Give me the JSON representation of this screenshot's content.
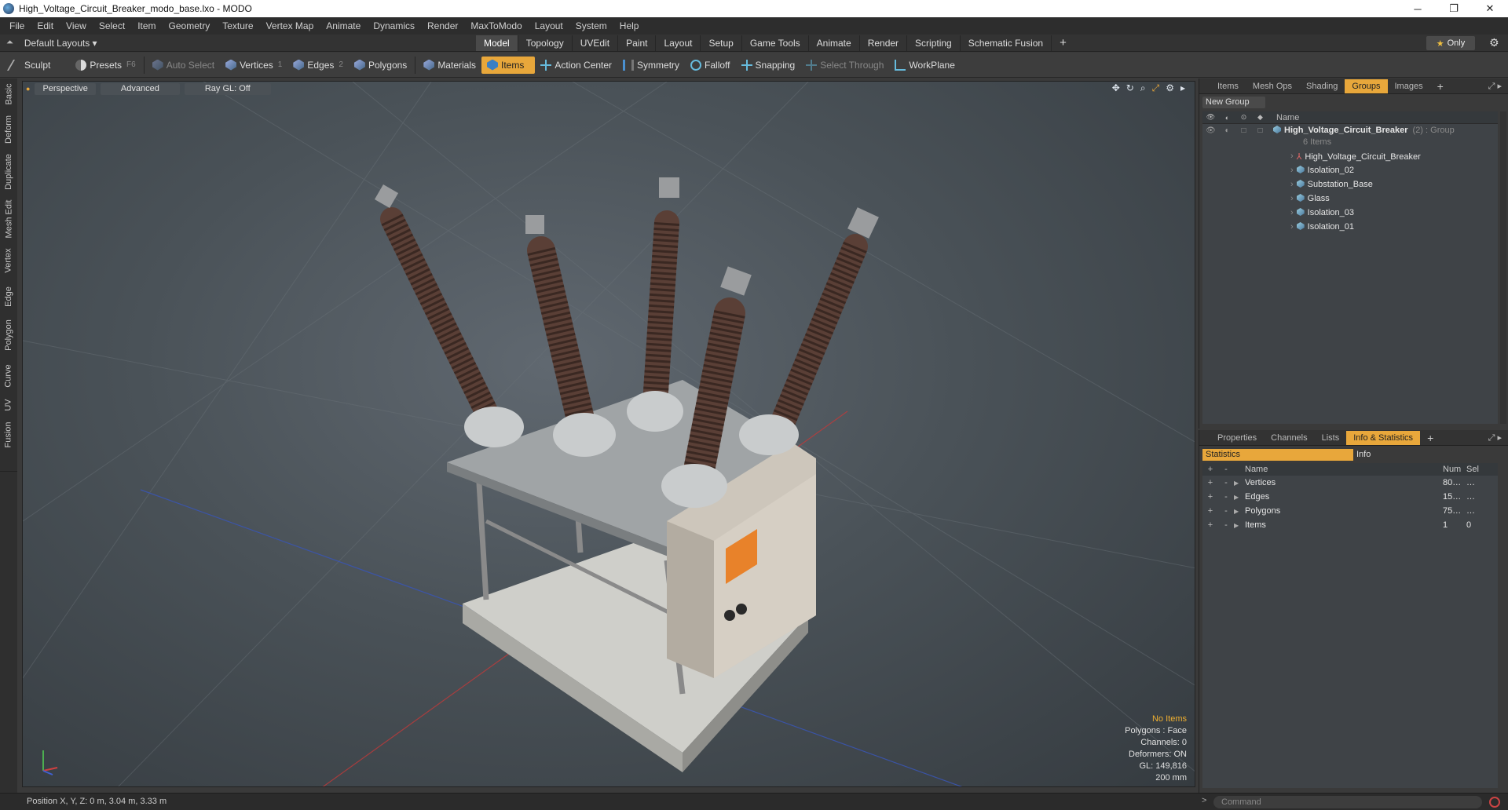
{
  "window": {
    "title": "High_Voltage_Circuit_Breaker_modo_base.lxo - MODO",
    "minimize": "─",
    "maximize": "❐",
    "close": "✕"
  },
  "menu": [
    "File",
    "Edit",
    "View",
    "Select",
    "Item",
    "Geometry",
    "Texture",
    "Vertex Map",
    "Animate",
    "Dynamics",
    "Render",
    "MaxToModo",
    "Layout",
    "System",
    "Help"
  ],
  "layout": {
    "selector": "Default Layouts ▾",
    "tabs": [
      "Model",
      "Topology",
      "UVEdit",
      "Paint",
      "Layout",
      "Setup",
      "Game Tools",
      "Animate",
      "Render",
      "Scripting",
      "Schematic Fusion"
    ],
    "active_tab": "Model",
    "only_label": "Only"
  },
  "toolbar": {
    "sculpt": "Sculpt",
    "presets": "Presets",
    "presets_key": "F6",
    "auto_select": "Auto Select",
    "vertices": "Vertices",
    "vertices_key": "1",
    "edges": "Edges",
    "edges_key": "2",
    "polygons": "Polygons",
    "materials": "Materials",
    "items": "Items",
    "action_center": "Action Center",
    "symmetry": "Symmetry",
    "falloff": "Falloff",
    "snapping": "Snapping",
    "select_through": "Select Through",
    "workplane": "WorkPlane"
  },
  "left_tabs": [
    "Basic",
    "Deform",
    "Duplicate",
    "Mesh Edit",
    "Vertex",
    "Edge",
    "Polygon",
    "Curve",
    "UV",
    "Fusion"
  ],
  "viewport": {
    "view_mode": "Perspective",
    "shading": "Advanced",
    "raygl": "Ray GL: Off",
    "info": {
      "items": "No Items",
      "polygons": "Polygons : Face",
      "channels": "Channels: 0",
      "deformers": "Deformers: ON",
      "gl": "GL: 149,816",
      "scale": "200 mm"
    }
  },
  "groups_panel": {
    "tabs": [
      "Items",
      "Mesh Ops",
      "Shading",
      "Groups",
      "Images"
    ],
    "active_tab": "Groups",
    "new_group": "New Group",
    "name_header": "Name",
    "group_name": "High_Voltage_Circuit_Breaker",
    "group_suffix": "(2) : Group",
    "group_count": "6 Items",
    "items": [
      "High_Voltage_Circuit_Breaker",
      "Isolation_02",
      "Substation_Base",
      "Glass",
      "Isolation_03",
      "Isolation_01"
    ]
  },
  "stats_panel": {
    "tabs": [
      "Properties",
      "Channels",
      "Lists",
      "Info & Statistics"
    ],
    "active_tab": "Info & Statistics",
    "subtab_statistics": "Statistics",
    "subtab_info": "Info",
    "headers": {
      "name": "Name",
      "num": "Num",
      "sel": "Sel"
    },
    "rows": [
      {
        "name": "Vertices",
        "num": "80…",
        "sel": "…"
      },
      {
        "name": "Edges",
        "num": "15…",
        "sel": "…"
      },
      {
        "name": "Polygons",
        "num": "75…",
        "sel": "…"
      },
      {
        "name": "Items",
        "num": "1",
        "sel": "0"
      }
    ]
  },
  "status": {
    "position": "Position X, Y, Z:  0 m, 3.04 m, 3.33 m",
    "command_placeholder": "Command"
  },
  "colors": {
    "accent": "#e8a73b",
    "viewport_bg": "#4a5258"
  }
}
